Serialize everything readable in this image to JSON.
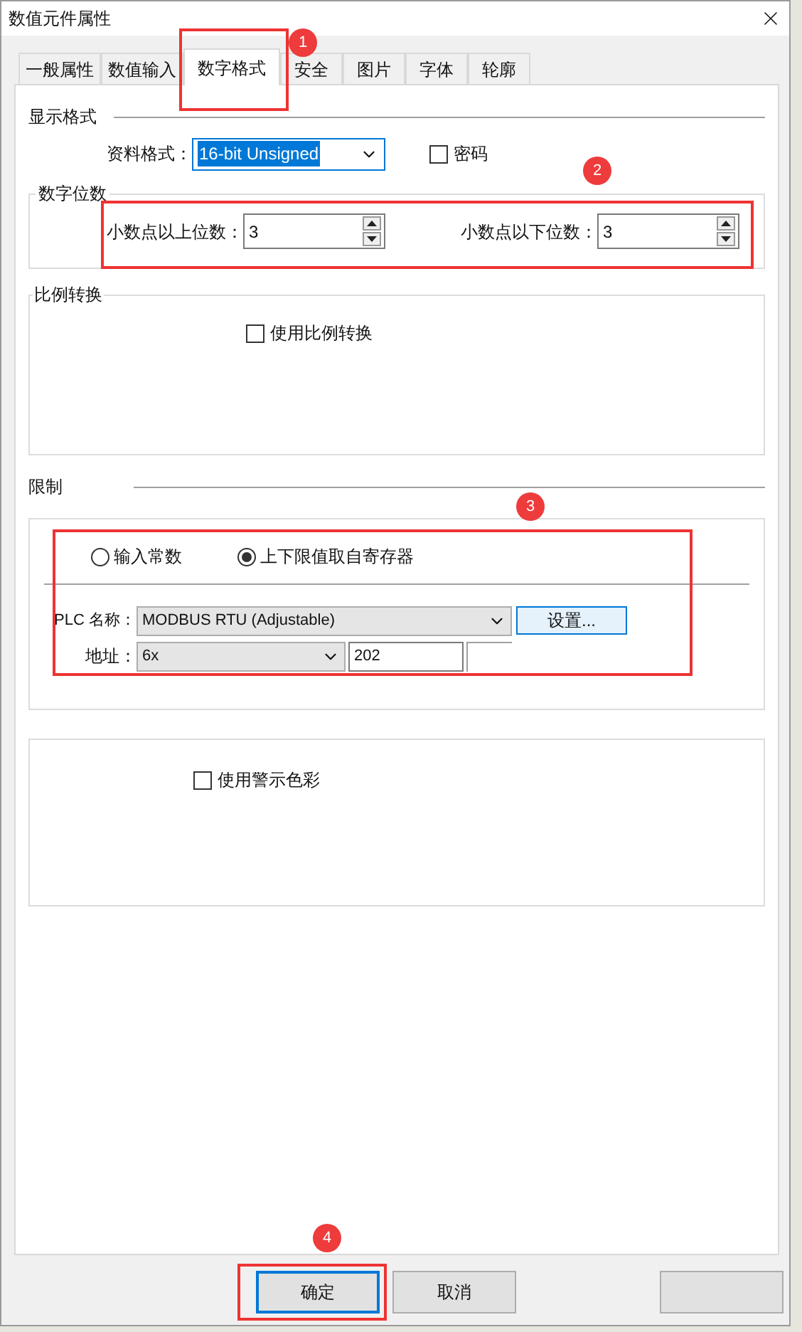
{
  "window": {
    "title": "数值元件属性"
  },
  "tabs": [
    {
      "label": "一般属性",
      "selected": false
    },
    {
      "label": "数值输入",
      "selected": false
    },
    {
      "label": "数字格式",
      "selected": true
    },
    {
      "label": "安全",
      "selected": false
    },
    {
      "label": "图片",
      "selected": false
    },
    {
      "label": "字体",
      "selected": false
    },
    {
      "label": "轮廓",
      "selected": false
    }
  ],
  "display_format": {
    "heading": "显示格式",
    "data_format_label": "资料格式：",
    "data_format_value": "16-bit Unsigned",
    "password": {
      "label": "密码",
      "checked": false
    }
  },
  "digits": {
    "heading": "数字位数",
    "integer_label": "小数点以上位数：",
    "integer_value": "3",
    "fraction_label": "小数点以下位数：",
    "fraction_value": "3"
  },
  "scaling": {
    "heading": "比例转换",
    "use_scaling": {
      "label": "使用比例转换",
      "checked": false
    }
  },
  "limits": {
    "heading": "限制",
    "sources": [
      {
        "label": "输入常数",
        "selected": false
      },
      {
        "label": "上下限值取自寄存器",
        "selected": true
      }
    ],
    "plc_label": "PLC 名称：",
    "plc_value": "MODBUS RTU (Adjustable)",
    "settings_button": "设置...",
    "address_label": "地址：",
    "address_type": "6x",
    "address_value": "202"
  },
  "alarm": {
    "use_alarm_color": {
      "label": "使用警示色彩",
      "checked": false
    }
  },
  "buttons": [
    {
      "kind": "text",
      "label": "确定",
      "focused": true
    },
    {
      "kind": "text",
      "label": "取消",
      "focused": false
    },
    {
      "kind": "blank",
      "focused": false
    }
  ],
  "annotations": [
    {
      "label": "1"
    },
    {
      "label": "2"
    },
    {
      "label": "3"
    },
    {
      "label": "4"
    }
  ]
}
